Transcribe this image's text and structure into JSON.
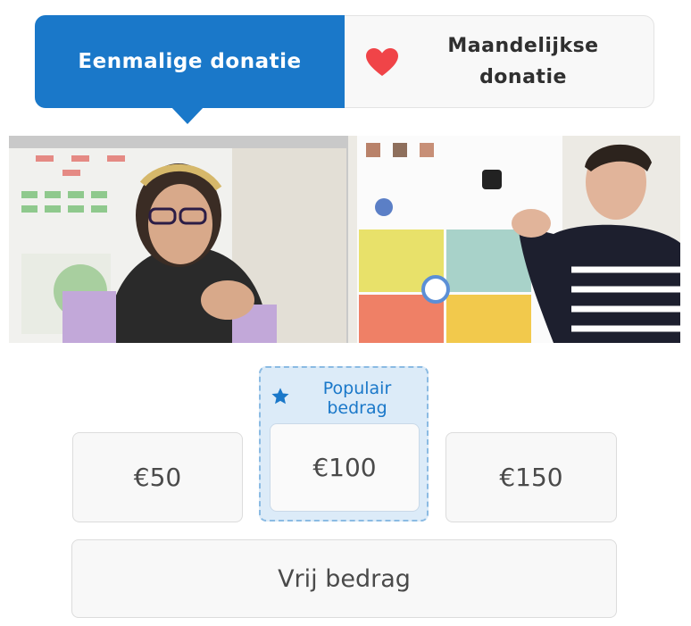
{
  "donation_type": {
    "once_label": "Eenmalige donatie",
    "monthly_label_line1": "Maandelijkse",
    "monthly_label_line2": "donatie",
    "selected": "once"
  },
  "icons": {
    "heart": "heart-icon",
    "star": "star-icon"
  },
  "colors": {
    "primary": "#1a78c9",
    "heart": "#f04448",
    "popular_bg": "#dcebf8"
  },
  "amounts": {
    "popular_line1": "Populair",
    "popular_line2": "bedrag",
    "options": [
      "€50",
      "€100",
      "€150"
    ],
    "selected": "€100",
    "free_label": "Vrij bedrag"
  }
}
